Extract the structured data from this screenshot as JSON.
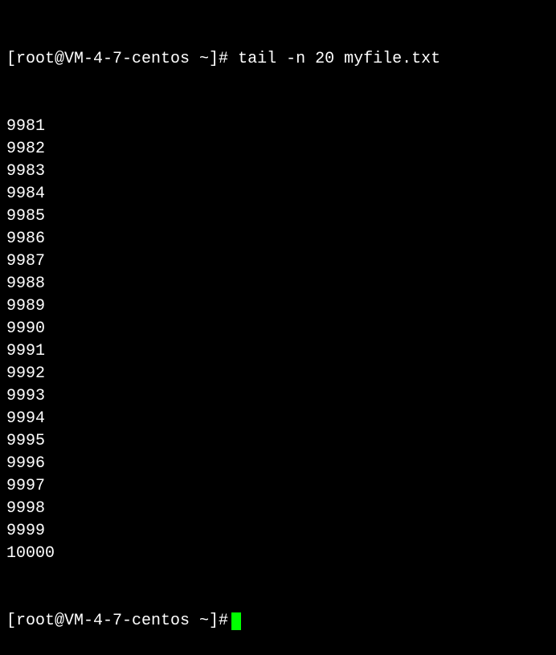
{
  "prompt1": {
    "user_host": "[root@VM-4-7-centos ~]#",
    "command": "tail -n 20 myfile.txt"
  },
  "output_lines": [
    "9981",
    "9982",
    "9983",
    "9984",
    "9985",
    "9986",
    "9987",
    "9988",
    "9989",
    "9990",
    "9991",
    "9992",
    "9993",
    "9994",
    "9995",
    "9996",
    "9997",
    "9998",
    "9999",
    "10000"
  ],
  "prompt2": {
    "user_host": "[root@VM-4-7-centos ~]#"
  }
}
